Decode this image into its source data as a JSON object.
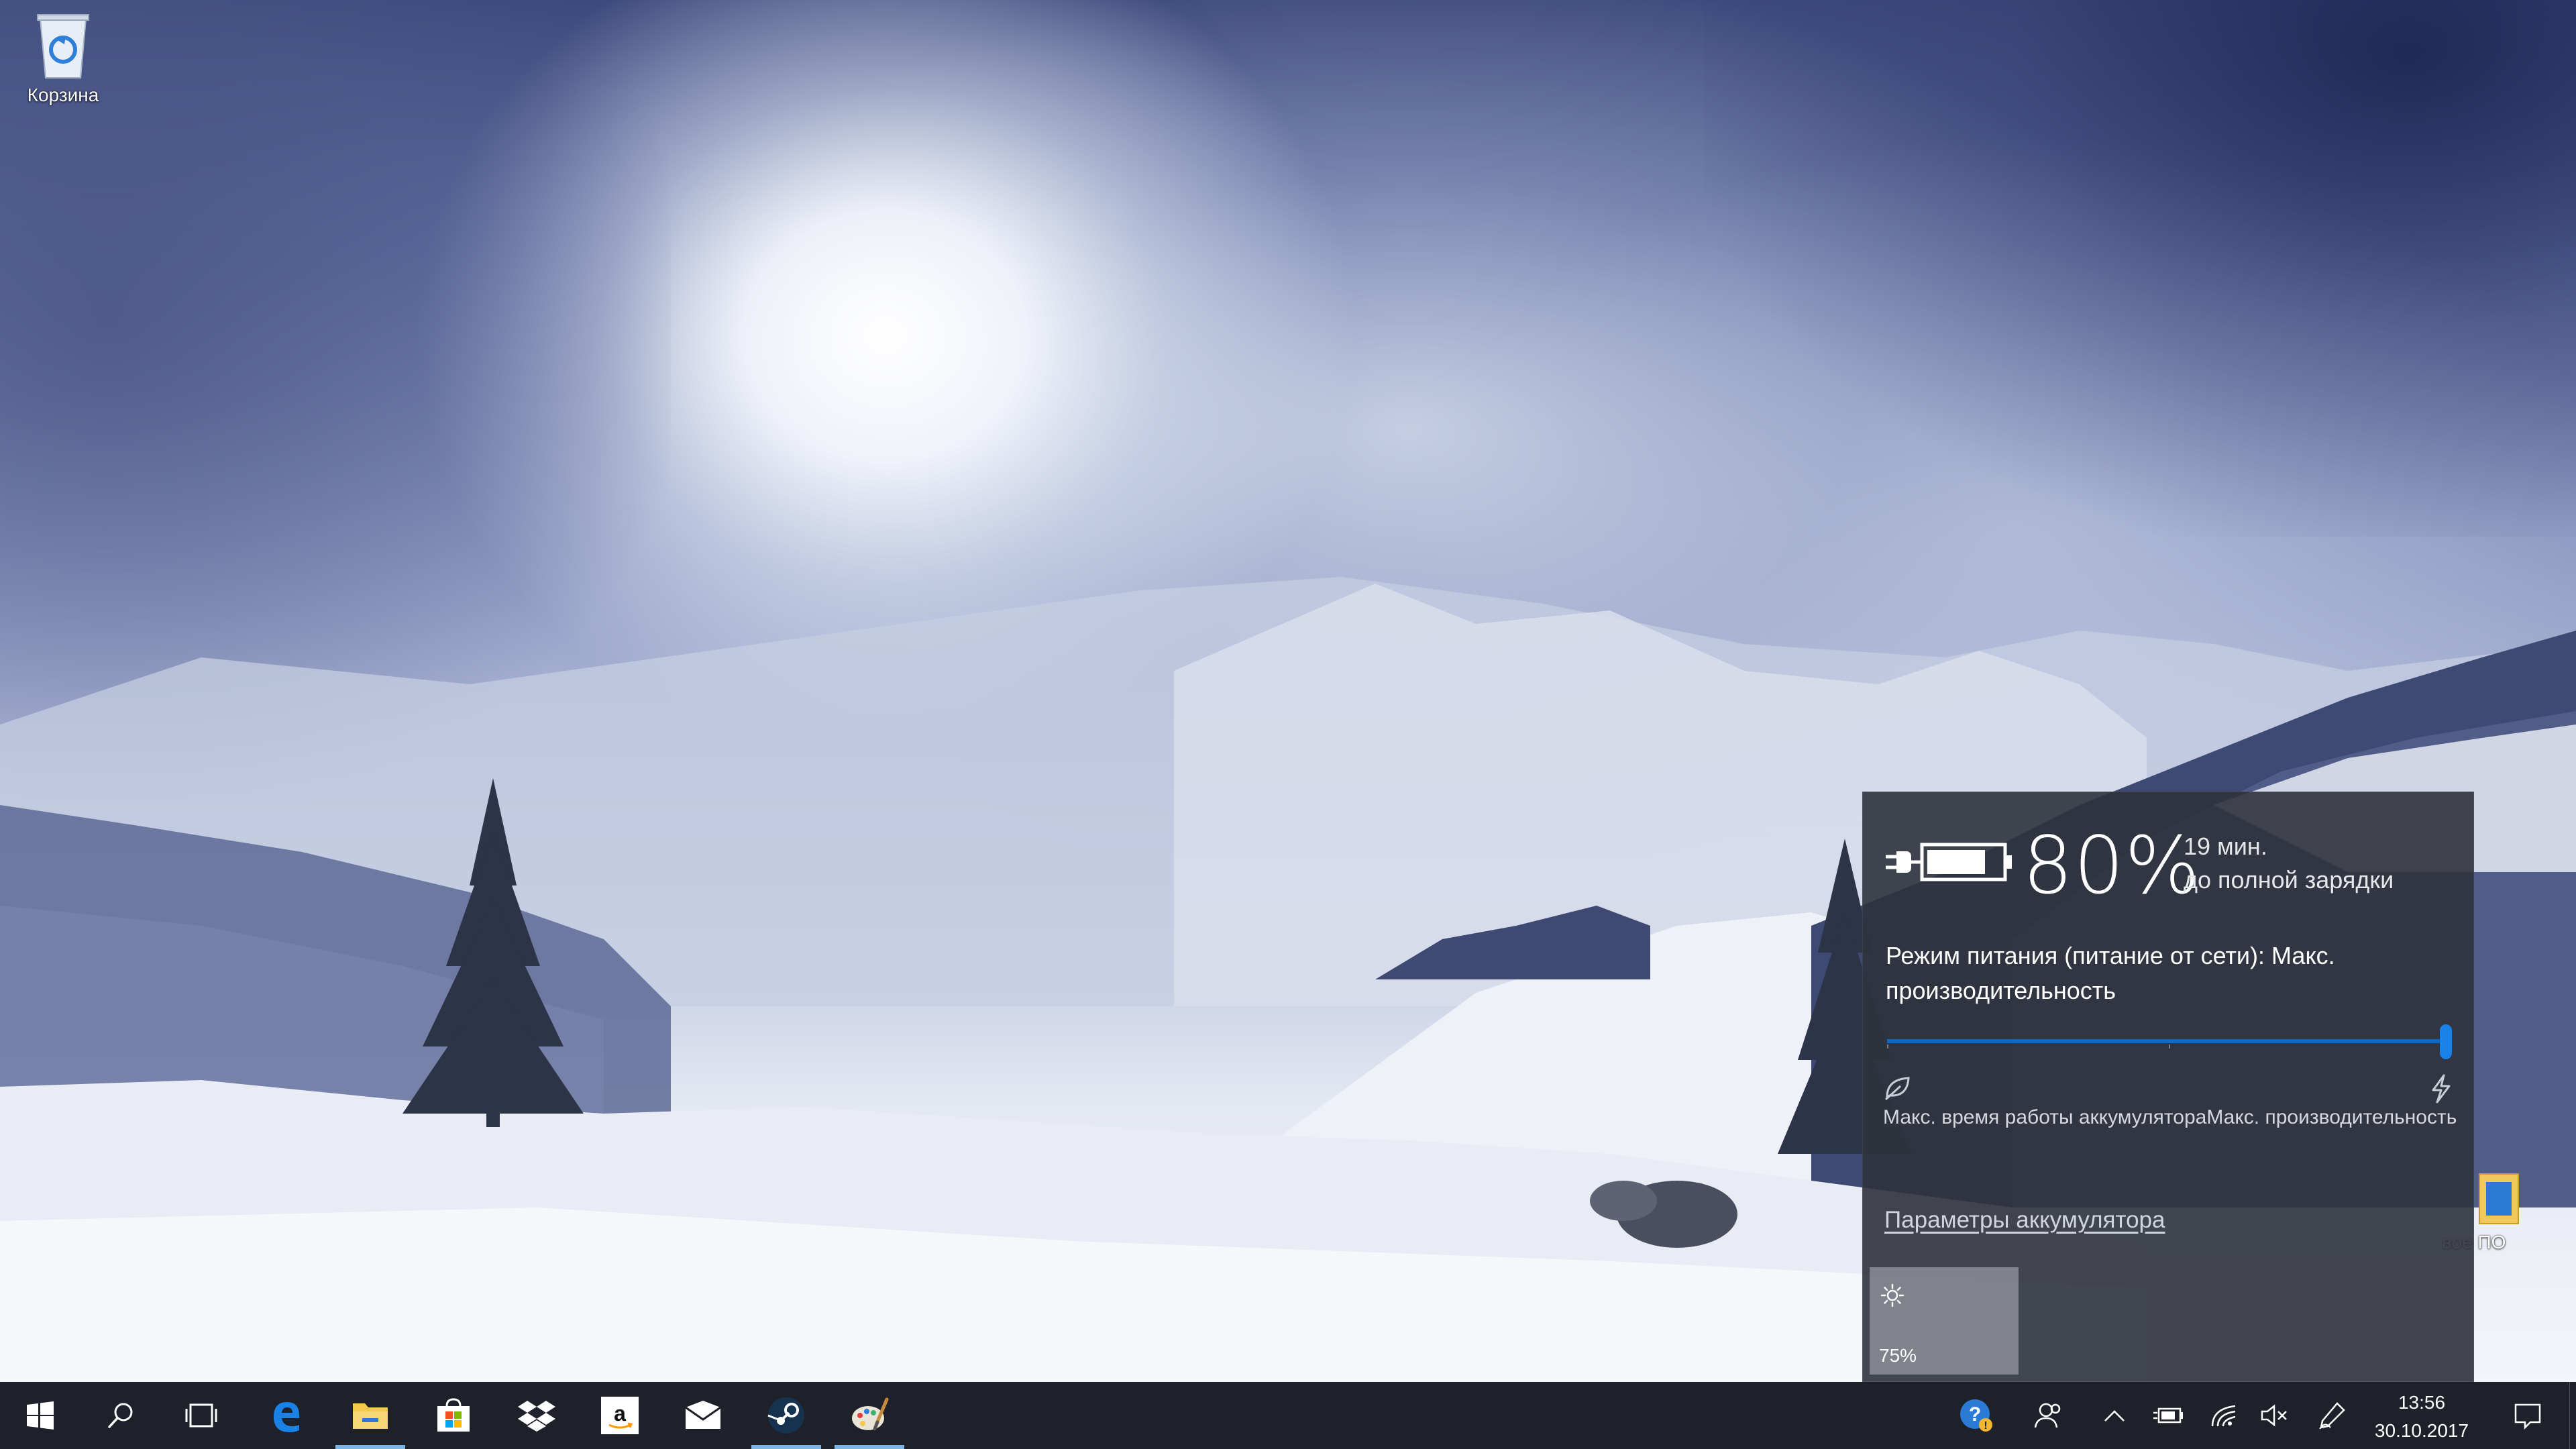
{
  "desktop": {
    "icons": [
      {
        "label": "Корзина",
        "icon": "recycle-bin-icon"
      },
      {
        "label": "вое ПО",
        "icon": "folder-icon"
      }
    ]
  },
  "battery_flyout": {
    "percent": "80%",
    "charge_level": 0.8,
    "time_remaining": "19 мин.",
    "time_caption": "до полной зарядки",
    "power_mode": "Режим питания (питание от сети): Макс. производительность",
    "slider_position": 1.0,
    "slider_left_label": "Макс. время работы аккумулятора",
    "slider_right_label": "Макс. производительность",
    "settings_link": "Параметры аккумулятора",
    "brightness_tile": {
      "icon": "brightness-icon",
      "value": "75%"
    },
    "accent_color": "#0b6bc8"
  },
  "taskbar": {
    "pinned": [
      {
        "name": "start-button",
        "icon": "windows-logo-icon"
      },
      {
        "name": "search-button",
        "icon": "search-icon"
      },
      {
        "name": "task-view-button",
        "icon": "task-view-icon"
      },
      {
        "name": "edge-button",
        "icon": "edge-icon"
      },
      {
        "name": "file-explorer-button",
        "icon": "folder-icon",
        "active": true
      },
      {
        "name": "store-button",
        "icon": "store-icon"
      },
      {
        "name": "dropbox-button",
        "icon": "dropbox-icon"
      },
      {
        "name": "amazon-button",
        "icon": "amazon-icon"
      },
      {
        "name": "mail-button",
        "icon": "mail-icon"
      },
      {
        "name": "steam-button",
        "icon": "steam-icon",
        "active": true
      },
      {
        "name": "paint-button",
        "icon": "paint-icon",
        "active": true
      }
    ],
    "tray": {
      "icons": [
        "help-icon",
        "people-icon",
        "chevron-up-icon",
        "battery-charging-icon",
        "wifi-icon",
        "volume-muted-icon",
        "pen-icon"
      ],
      "time": "13:56",
      "date": "30.10.2017",
      "notification_icon": "action-center-icon"
    }
  }
}
